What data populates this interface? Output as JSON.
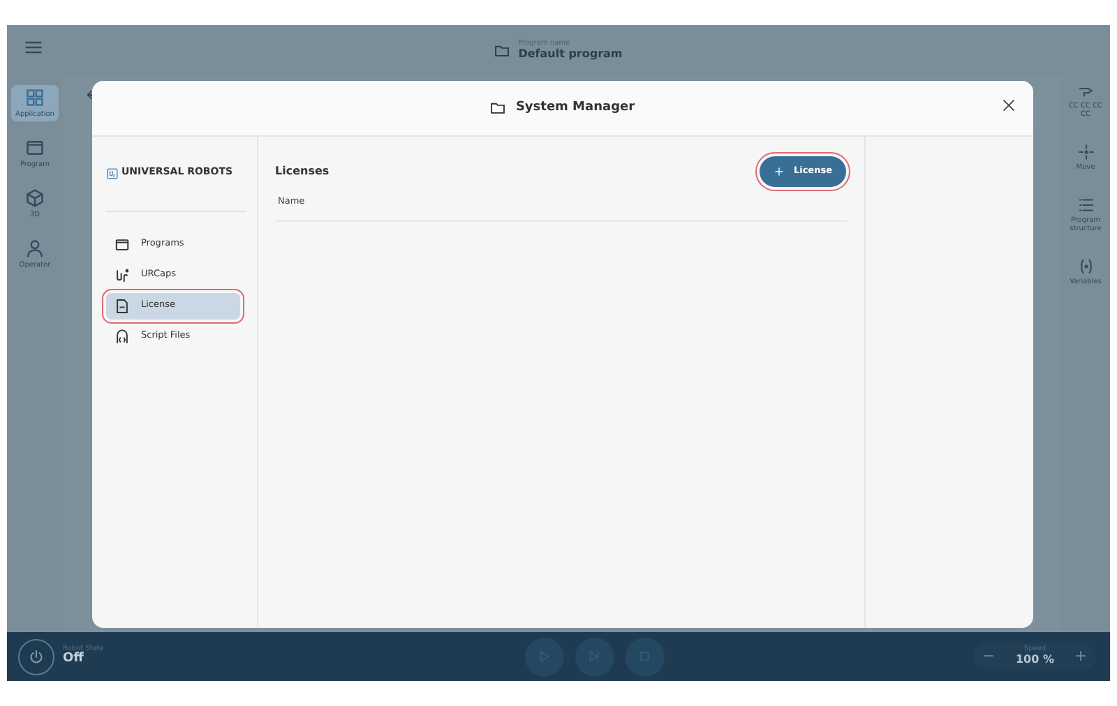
{
  "top_bar": {
    "label": "Program name",
    "value": "Default program"
  },
  "left_rail": [
    {
      "label": "Application",
      "selected": true
    },
    {
      "label": "Program",
      "selected": false
    },
    {
      "label": "3D",
      "selected": false
    },
    {
      "label": "Operator",
      "selected": false
    }
  ],
  "right_rail": [
    {
      "label": "CC CC CC CC"
    },
    {
      "label": "Move"
    },
    {
      "label": "Program structure"
    },
    {
      "label": "Variables"
    }
  ],
  "dialog": {
    "title": "System Manager",
    "brand": "UNIVERSAL ROBOTS",
    "nav": [
      {
        "label": "Programs",
        "selected": false,
        "highlighted": false
      },
      {
        "label": "URCaps",
        "selected": false,
        "highlighted": false
      },
      {
        "label": "License",
        "selected": true,
        "highlighted": true
      },
      {
        "label": "Script Files",
        "selected": false,
        "highlighted": false
      }
    ],
    "heading": "Licenses",
    "add_button": {
      "label": "License",
      "highlighted": true
    },
    "columns": [
      "Name"
    ]
  },
  "bottom_bar": {
    "state_label": "Robot State",
    "state": "Off",
    "speed_label": "Speed",
    "speed": "100 %"
  }
}
